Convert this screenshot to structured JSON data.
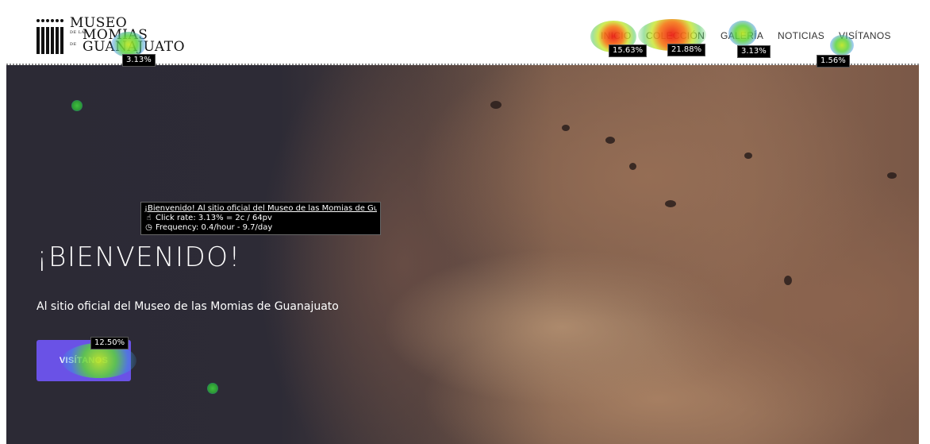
{
  "logo": {
    "line1": "MUSEO",
    "line2": "MOMIAS",
    "line3": "GUANAJUATO",
    "prefix_de_las": "DE LAS",
    "prefix_de": "DE"
  },
  "nav": {
    "items": [
      {
        "label": "INICIO"
      },
      {
        "label": "COLECCIÓN"
      },
      {
        "label": "GALERÍA"
      },
      {
        "label": "NOTICIAS"
      },
      {
        "label": "VISÍTANOS"
      }
    ]
  },
  "hero": {
    "title": "¡BIENVENIDO!",
    "subtitle": "Al sitio oficial del Museo de las Momias de Guanajuato",
    "button_label": "VISÍTANOS"
  },
  "heatmap": {
    "badges": {
      "logo": "3.13%",
      "inicio": "15.63%",
      "coleccion": "21.88%",
      "galeria": "3.13%",
      "visitanos_nav": "1.56%",
      "hero_button": "12.50%"
    },
    "tooltip": {
      "title": "¡Bienvenido! Al sitio oficial del Museo de las Momias de Gua",
      "click_rate": "Click rate: 3.13%  =  2c / 64pv",
      "frequency": "Frequency: 0.4/hour - 9.7/day"
    },
    "colors": {
      "hot": "#eb1e14",
      "warm": "#f57814",
      "cool": "#5ad23c",
      "cold": "#3c78e6"
    }
  },
  "colors": {
    "button_accent": "#6a52e6",
    "hero_dark": "#2c2a35",
    "hero_flesh": "#8a6651"
  }
}
